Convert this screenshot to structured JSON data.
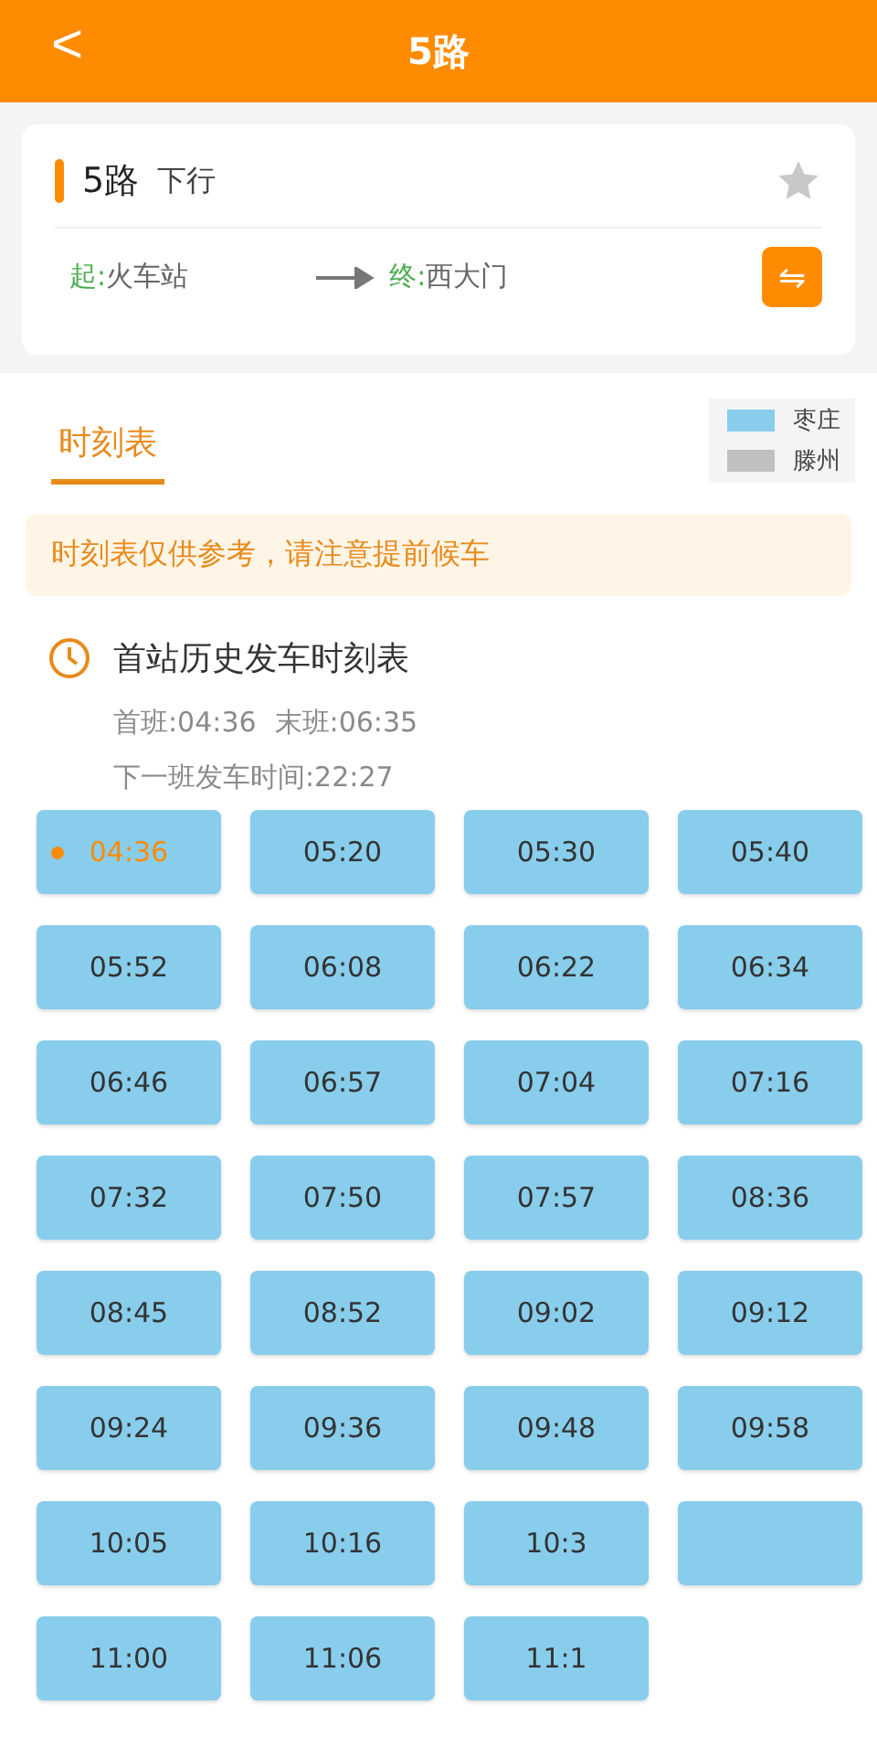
{
  "header": {
    "back": "<",
    "title": "5路"
  },
  "route": {
    "name": "5路",
    "direction": "下行",
    "favorite": false,
    "start_label": "起:",
    "start": "火车站",
    "end_label": "终:",
    "end": "西大门",
    "swap": "⇋"
  },
  "tabs": [
    {
      "label": "时刻表",
      "selected": true
    }
  ],
  "legend": [
    {
      "label": "枣庄",
      "color": "#88cdec"
    },
    {
      "label": "滕州",
      "color": "#c0c0c0"
    }
  ],
  "notice": "时刻表仅供参考，请注意提前候车",
  "schedule": {
    "title": "首站历史发车时刻表",
    "first": "首班:04:36",
    "last": "末班:06:35",
    "next": "下一班发车时间:22:27"
  },
  "times": [
    {
      "time": "04:36",
      "selected": true
    },
    {
      "time": "05:20",
      "selected": false
    },
    {
      "time": "05:30",
      "selected": false
    },
    {
      "time": "05:40",
      "selected": false
    },
    {
      "time": "05:52",
      "selected": false
    },
    {
      "time": "06:08",
      "selected": false
    },
    {
      "time": "06:22",
      "selected": false
    },
    {
      "time": "06:34",
      "selected": false
    },
    {
      "time": "06:46",
      "selected": false
    },
    {
      "time": "06:57",
      "selected": false
    },
    {
      "time": "07:04",
      "selected": false
    },
    {
      "time": "07:16",
      "selected": false
    },
    {
      "time": "07:32",
      "selected": false
    },
    {
      "time": "07:50",
      "selected": false
    },
    {
      "time": "07:57",
      "selected": false
    },
    {
      "time": "08:36",
      "selected": false
    },
    {
      "time": "08:45",
      "selected": false
    },
    {
      "time": "08:52",
      "selected": false
    },
    {
      "time": "09:02",
      "selected": false
    },
    {
      "time": "09:12",
      "selected": false
    },
    {
      "time": "09:24",
      "selected": false
    },
    {
      "time": "09:36",
      "selected": false
    },
    {
      "time": "09:48",
      "selected": false
    },
    {
      "time": "09:58",
      "selected": false
    },
    {
      "time": "10:05",
      "selected": false
    },
    {
      "time": "10:16",
      "selected": false
    },
    {
      "time": "10:3",
      "selected": false
    },
    {
      "selected": false
    },
    {
      "time": "11:00",
      "selected": false
    },
    {
      "time": "11:06",
      "selected": false
    },
    {
      "time": "11:1",
      "selected": false
    }
  ]
}
